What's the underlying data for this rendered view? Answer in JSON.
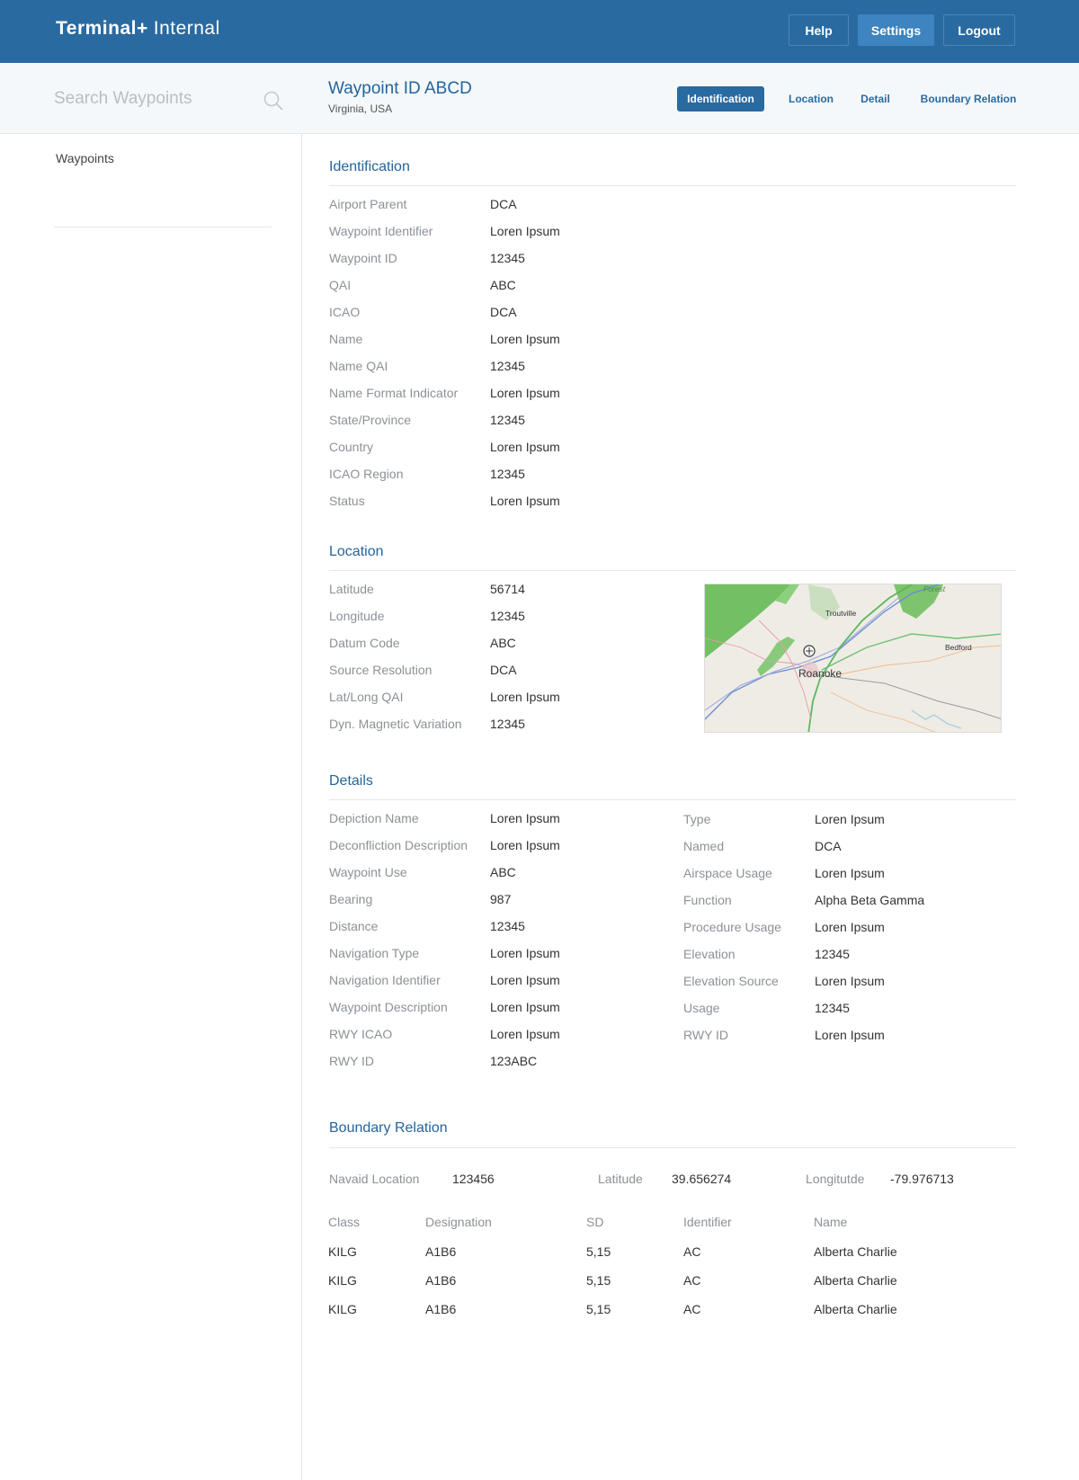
{
  "header": {
    "logo_bold": "Terminal+",
    "logo_light": "Internal",
    "help_label": "Help",
    "settings_label": "Settings",
    "logout_label": "Logout"
  },
  "sidebar": {
    "search_placeholder": "Search Waypoints",
    "items": [
      {
        "label": "Waypoints"
      }
    ]
  },
  "waypoint": {
    "title": "Waypoint ID ABCD",
    "subtitle": "Virginia, USA"
  },
  "tabs": [
    {
      "label": "Identification",
      "active": true
    },
    {
      "label": "Location",
      "active": false
    },
    {
      "label": "Detail",
      "active": false
    },
    {
      "label": "Boundary Relation",
      "active": false
    }
  ],
  "identification": {
    "heading": "Identification",
    "rows": [
      {
        "label": "Airport Parent",
        "value": "DCA"
      },
      {
        "label": "Waypoint Identifier",
        "value": "Loren Ipsum"
      },
      {
        "label": "Waypoint ID",
        "value": "12345"
      },
      {
        "label": "QAI",
        "value": "ABC"
      },
      {
        "label": "ICAO",
        "value": "DCA"
      },
      {
        "label": "Name",
        "value": "Loren Ipsum"
      },
      {
        "label": "Name QAI",
        "value": "12345"
      },
      {
        "label": "Name Format Indicator",
        "value": "Loren Ipsum"
      },
      {
        "label": "State/Province",
        "value": "12345"
      },
      {
        "label": "Country",
        "value": "Loren Ipsum"
      },
      {
        "label": "ICAO Region",
        "value": "12345"
      },
      {
        "label": "Status",
        "value": "Loren Ipsum"
      }
    ]
  },
  "location": {
    "heading": "Location",
    "rows": [
      {
        "label": "Latitude",
        "value": "56714"
      },
      {
        "label": "Longitude",
        "value": "12345"
      },
      {
        "label": "Datum Code",
        "value": "ABC"
      },
      {
        "label": "Source Resolution",
        "value": "DCA"
      },
      {
        "label": "Lat/Long QAI",
        "value": "Loren Ipsum"
      },
      {
        "label": "Dyn. Magnetic Variation",
        "value": "12345"
      }
    ],
    "map": {
      "city": "Roanoke",
      "labels": [
        "Troutville",
        "Bedford",
        "Forest"
      ]
    }
  },
  "details": {
    "heading": "Details",
    "left": [
      {
        "label": "Depiction Name",
        "value": "Loren Ipsum"
      },
      {
        "label": "Deconfliction Description",
        "value": "Loren Ipsum"
      },
      {
        "label": "Waypoint Use",
        "value": "ABC"
      },
      {
        "label": "Bearing",
        "value": "987"
      },
      {
        "label": "Distance",
        "value": "12345"
      },
      {
        "label": "Navigation Type",
        "value": "Loren Ipsum"
      },
      {
        "label": "Navigation Identifier",
        "value": "Loren Ipsum"
      },
      {
        "label": "Waypoint Description",
        "value": "Loren Ipsum"
      },
      {
        "label": "RWY ICAO",
        "value": "Loren Ipsum"
      },
      {
        "label": "RWY ID",
        "value": "123ABC"
      }
    ],
    "right": [
      {
        "label": "Type",
        "value": "Loren Ipsum"
      },
      {
        "label": "Named",
        "value": "DCA"
      },
      {
        "label": "Airspace Usage",
        "value": "Loren Ipsum"
      },
      {
        "label": "Function",
        "value": "Alpha Beta Gamma"
      },
      {
        "label": "Procedure Usage",
        "value": "Loren Ipsum"
      },
      {
        "label": "Elevation",
        "value": "12345"
      },
      {
        "label": "Elevation Source",
        "value": "Loren Ipsum"
      },
      {
        "label": "Usage",
        "value": "12345"
      },
      {
        "label": "RWY ID",
        "value": "Loren Ipsum"
      }
    ]
  },
  "boundary": {
    "heading": "Boundary Relation",
    "navaid_label": "Navaid Location",
    "navaid_value": "123456",
    "lat_label": "Latitude",
    "lat_value": "39.656274",
    "lon_label": "Longitutde",
    "lon_value": "-79.976713",
    "columns": [
      "Class",
      "Designation",
      "SD",
      "Identifier",
      "Name"
    ],
    "rows": [
      [
        "KILG",
        "A1B6",
        "5,15",
        "AC",
        "Alberta Charlie"
      ],
      [
        "KILG",
        "A1B6",
        "5,15",
        "AC",
        "Alberta Charlie"
      ],
      [
        "KILG",
        "A1B6",
        "5,15",
        "AC",
        "Alberta Charlie"
      ]
    ]
  },
  "colors": {
    "brand": "#296aa1",
    "heading": "#24649c",
    "label": "#8c9197"
  }
}
